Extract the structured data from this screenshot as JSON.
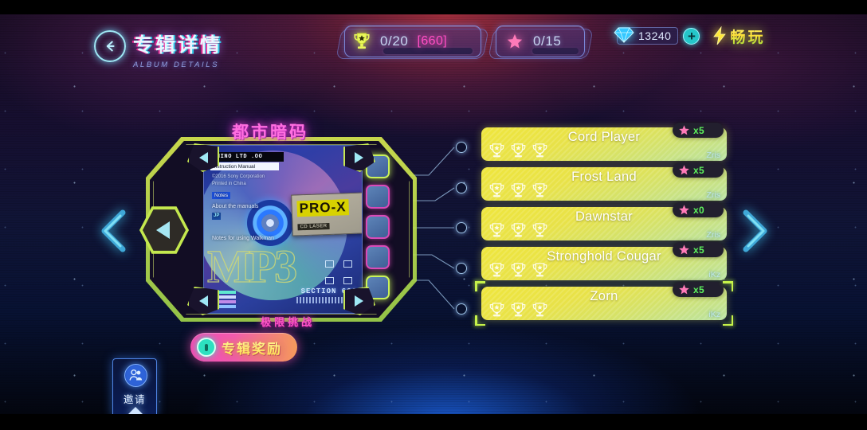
{
  "header": {
    "back_icon": "arrow-left-circle-icon",
    "title_cn": "专辑详情",
    "title_en": "ALBUM DETAILS"
  },
  "hud": {
    "trophy": {
      "icon": "trophy-icon",
      "value": "0/20",
      "bracket": "[660]"
    },
    "star": {
      "icon": "star-icon",
      "value": "0/15"
    },
    "gem": {
      "icon": "diamond-icon",
      "value": "13240",
      "plus_label": "+"
    },
    "play_free": {
      "icon": "lightning-bolt-icon",
      "label": "畅玩"
    }
  },
  "album": {
    "title": "都市暗码",
    "art": {
      "manual_header": "RHINO LTD .OO",
      "manual_sub": "Instruction Manual",
      "copy_line": "©2016 Sony Corporation  Printed in China",
      "tag_blue": "Notes",
      "about_line": "About the manuals",
      "tag_cyan": "JP",
      "notes_line": "Notes for using Walkman",
      "big_word": "MP3",
      "card_title": "PRO-X",
      "card_small": "CD LASER",
      "section": "SECTION 666"
    },
    "slot_count": 5
  },
  "nav": {
    "prev_chevron": "chevron-left-icon",
    "next_chevron": "chevron-right-icon",
    "prev_hex": "hex-prev-button"
  },
  "songs": [
    {
      "name": "Cord Player",
      "artist": "Zris",
      "star_count": "x5",
      "trophies": 3
    },
    {
      "name": "Frost Land",
      "artist": "Zris",
      "star_count": "x5",
      "trophies": 3
    },
    {
      "name": "Dawnstar",
      "artist": "Zris",
      "star_count": "x0",
      "trophies": 3
    },
    {
      "name": "Stronghold Cougar",
      "artist": "iKz",
      "star_count": "x5",
      "trophies": 3
    },
    {
      "name": "Zorn",
      "artist": "iKz",
      "star_count": "x5",
      "trophies": 3,
      "selected": true
    }
  ],
  "bottom": {
    "extreme_label": "极限挑战",
    "reward_label": "专辑奖励",
    "reward_icon": "medal-icon",
    "invite_label": "邀请",
    "invite_icon": "people-icon"
  },
  "colors": {
    "accent_yellow": "#e8e23c",
    "accent_pink": "#ff4ec4",
    "accent_cyan": "#9fe8f5",
    "accent_green": "#c6f24a",
    "row_gradient_start": "#efe63c",
    "row_gradient_end": "#b9e3a4"
  }
}
